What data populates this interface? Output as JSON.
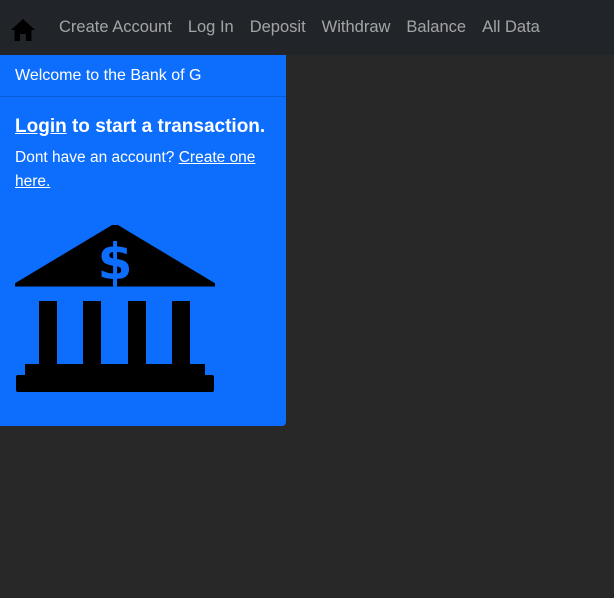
{
  "nav": {
    "home_icon": "home-icon",
    "links": [
      {
        "label": "Create Account"
      },
      {
        "label": "Log In"
      },
      {
        "label": "Deposit"
      },
      {
        "label": "Withdraw"
      },
      {
        "label": "Balance"
      },
      {
        "label": "All Data"
      }
    ]
  },
  "card": {
    "header": "Welcome to the Bank of G",
    "title_link": "Login",
    "title_rest": " to start a transaction.",
    "text_prefix": "Dont have an account? ",
    "text_link": "Create one here.",
    "icon": "bank-icon",
    "bank_symbol": "$"
  },
  "colors": {
    "page_bg": "#282828",
    "navbar_bg": "#212529",
    "card_bg": "#0d6efd",
    "icon": "#000000"
  }
}
